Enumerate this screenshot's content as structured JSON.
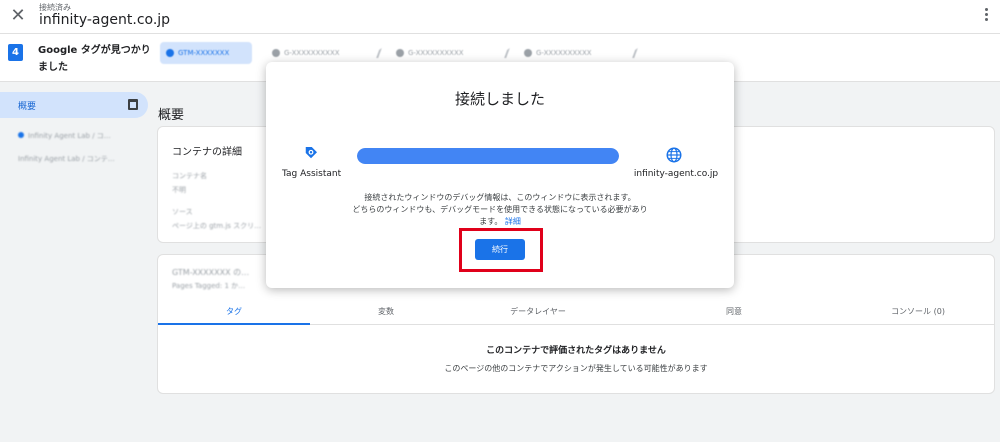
{
  "topbar": {
    "status": "接続済み",
    "domain": "infinity-agent.co.jp"
  },
  "tagbar": {
    "count": "4",
    "found_text": "Google タグが見つかりました",
    "chips": [
      {
        "label": "GTM-XXXXXXX",
        "active": true
      },
      {
        "label": "G-XXXXXXXXXX",
        "active": false
      },
      {
        "label": "G-XXXXXXXXXX",
        "active": false
      },
      {
        "label": "G-XXXXXXXXXX",
        "active": false
      }
    ]
  },
  "sidebar": {
    "summary_label": "概要",
    "entries": [
      "Infinity Agent Lab / コ…",
      "Infinity Agent Lab / コンテ…"
    ]
  },
  "main": {
    "title": "概要",
    "container_card": {
      "heading": "コンテナの詳細",
      "fields": [
        "コンテナ名",
        "不明",
        "ソース",
        "ページ上の gtm.js スクリ…"
      ]
    },
    "tag_card": {
      "header": "GTM-XXXXXXX の…",
      "subheader": "Pages Tagged: 1 か…",
      "tabs": [
        "タグ",
        "変数",
        "データレイヤー",
        "同意",
        "コンソール (0)"
      ],
      "empty_title": "このコンテナで評価されたタグはありません",
      "empty_subtitle": "このページの他のコンテナでアクションが発生している可能性があります"
    }
  },
  "modal": {
    "title": "接続しました",
    "left_label": "Tag Assistant",
    "right_label": "infinity-agent.co.jp",
    "progress": 1.0,
    "message_line1": "接続されたウィンドウのデバッグ情報は、このウィンドウに表示されます。",
    "message_line2": "どちらのウィンドウも、デバッグモードを使用できる状態になっている必要があり",
    "message_line3": "ます。",
    "details_link": "詳細",
    "continue_label": "続行"
  },
  "colors": {
    "accent": "#1a73e8",
    "highlight_box": "#e0001a"
  }
}
